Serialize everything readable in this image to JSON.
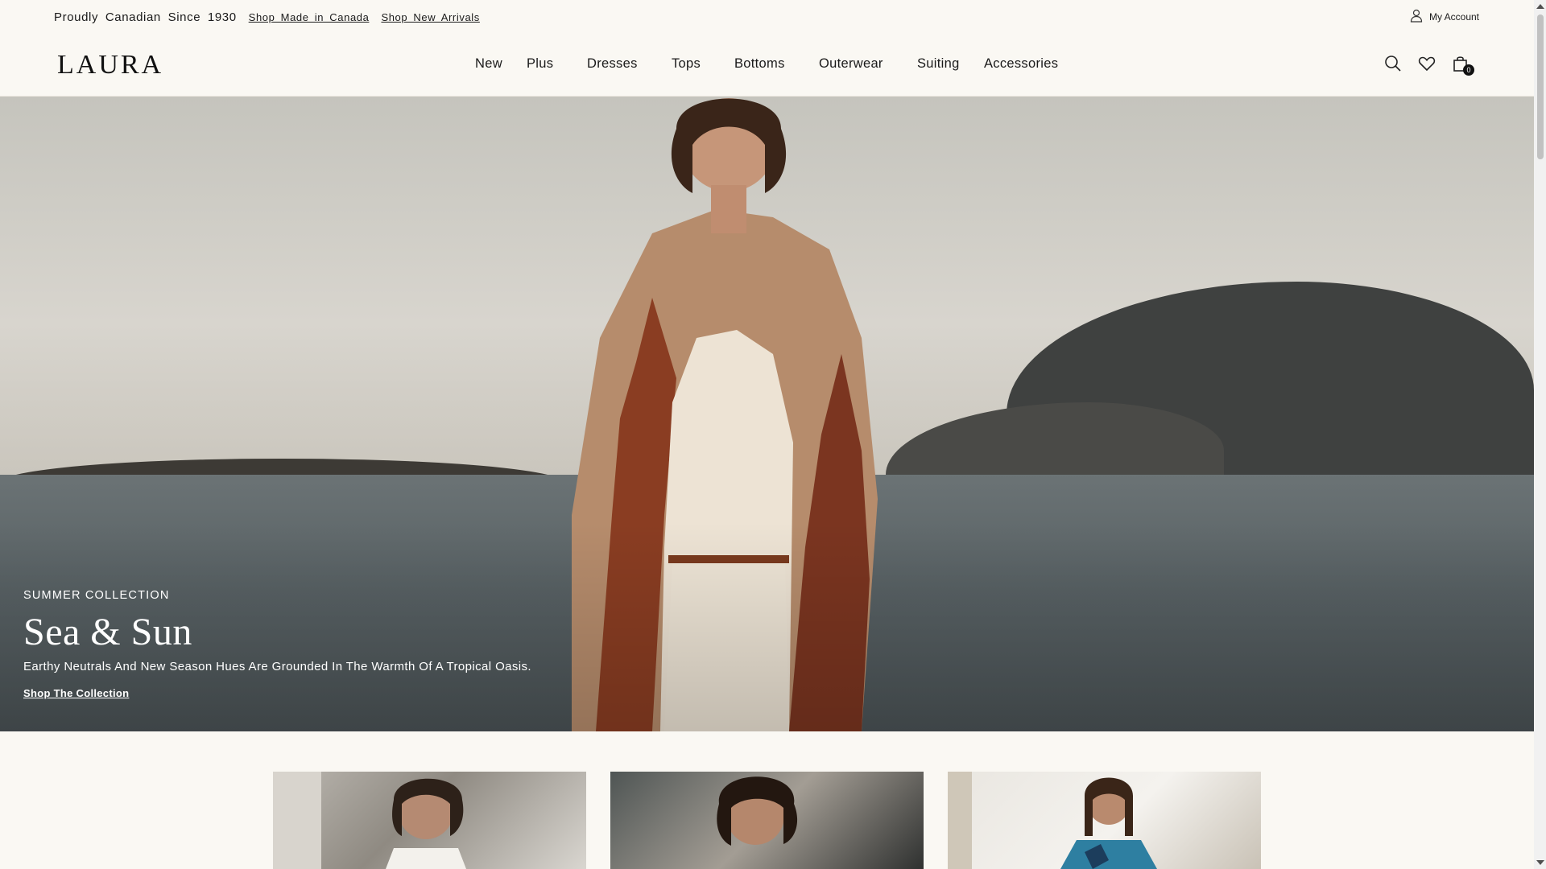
{
  "topbar": {
    "tagline": "Proudly Canadian Since 1930",
    "link_made_in_canada": "Shop Made in Canada ",
    "link_new_arrivals": "Shop New Arrivals",
    "account_label": "My Account"
  },
  "header": {
    "logo": "LAURA",
    "nav": [
      "New",
      "Plus",
      "Dresses",
      "Tops",
      "Bottoms",
      "Outerwear",
      "Suiting",
      "Accessories"
    ],
    "icons": [
      "search-icon",
      "heart-icon",
      "bag-icon"
    ],
    "cart_count": "0"
  },
  "hero": {
    "eyebrow": "SUMMER COLLECTION",
    "headline": "Sea & Sun",
    "description": "Earthy Neutrals And New Season Hues Are Grounded In The Warmth Of A Tropical Oasis.",
    "cta": "Shop The Collection"
  },
  "colors": {
    "background": "#faf8f3",
    "text": "#1a1a1a",
    "hero_text": "#ffffff"
  }
}
